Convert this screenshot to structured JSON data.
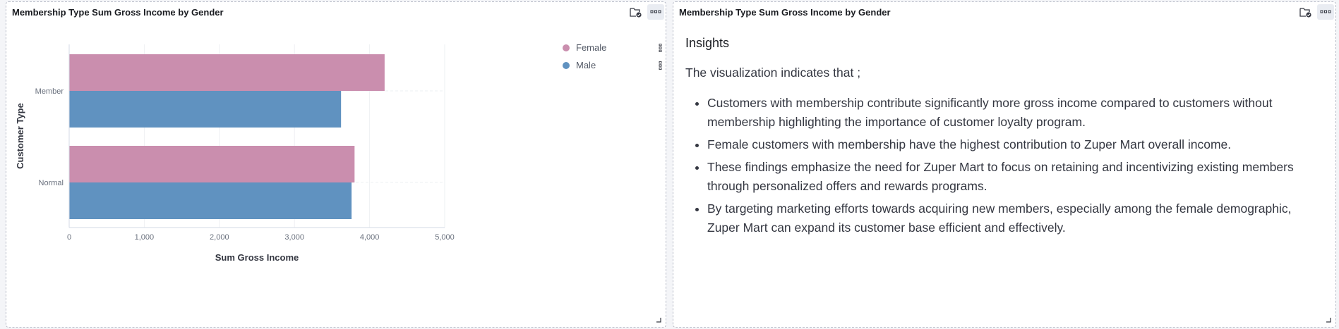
{
  "left_panel": {
    "title": "Membership Type Sum Gross Income by Gender"
  },
  "right_panel": {
    "title": "Membership Type Sum Gross Income by Gender",
    "heading": "Insights",
    "intro": "The visualization indicates that ;",
    "bullets": [
      "Customers with membership contribute significantly more gross income compared to customers without membership highlighting the importance of customer loyalty program.",
      "Female customers with membership have the highest contribution to Zuper Mart overall income.",
      "These findings emphasize the need for Zuper Mart to focus on retaining and incentivizing existing members through personalized offers and rewards programs.",
      "By targeting marketing efforts towards acquiring new members, especially among the female demographic, Zuper Mart can expand its customer base efficient and effectively."
    ]
  },
  "icons": {
    "panel_action": "folder-check-icon",
    "panel_menu": "more-horizontal-icon",
    "legend_action": "more-vertical-icon",
    "resize": "resize-handle-icon"
  },
  "colors": {
    "female": "#ca8eae",
    "male": "#6092c0"
  },
  "chart_data": {
    "type": "bar",
    "orientation": "horizontal",
    "categories": [
      "Member",
      "Normal"
    ],
    "series": [
      {
        "name": "Female",
        "values": [
          4200,
          3800
        ]
      },
      {
        "name": "Male",
        "values": [
          3620,
          3760
        ]
      }
    ],
    "xlabel": "Sum Gross Income",
    "ylabel": "Customer Type",
    "xlim": [
      0,
      5000
    ],
    "xticks": [
      "0",
      "1,000",
      "2,000",
      "3,000",
      "4,000",
      "5,000"
    ],
    "xtick_values": [
      0,
      1000,
      2000,
      3000,
      4000,
      5000
    ],
    "legend": "top-right",
    "grid": true
  }
}
